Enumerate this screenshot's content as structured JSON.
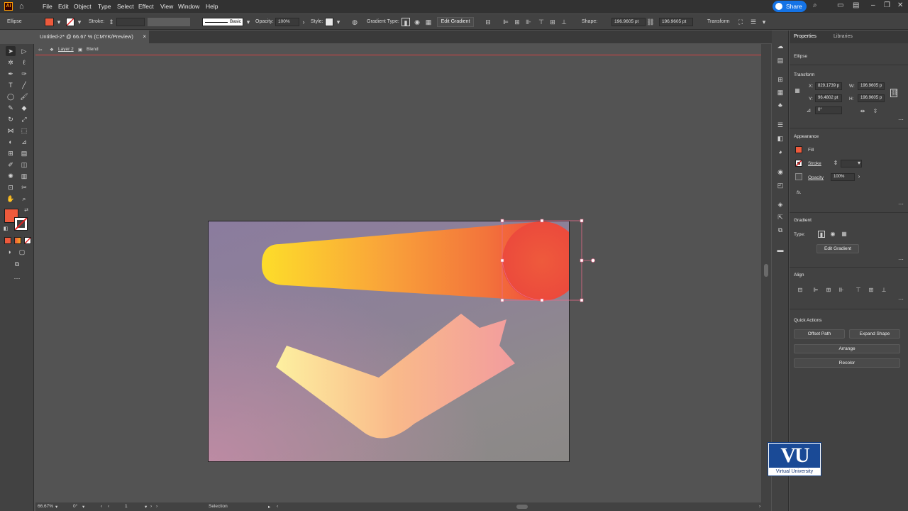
{
  "app": {
    "logo_text": "Ai"
  },
  "menu": [
    "File",
    "Edit",
    "Object",
    "Type",
    "Select",
    "Effect",
    "View",
    "Window",
    "Help"
  ],
  "share_label": "Share",
  "control_bar": {
    "object_type": "Ellipse",
    "stroke_label": "Stroke:",
    "brush_label": "Basic",
    "opacity_label": "Opacity:",
    "opacity_value": "100%",
    "style_label": "Style:",
    "gradient_type_label": "Gradient Type:",
    "edit_gradient_label": "Edit Gradient",
    "shape_label": "Shape:",
    "shape_w": "196.9605 pt",
    "shape_h": "196.9605 pt",
    "transform_label": "Transform"
  },
  "document": {
    "tab_title": "Untitled-2* @ 66.67 % (CMYK/Preview)",
    "close": "×"
  },
  "breadcrumb": {
    "layer": "Layer 2",
    "group": "Blend"
  },
  "status": {
    "zoom": "66.67%",
    "rotation": "0°",
    "artboard": "1",
    "tool": "Selection"
  },
  "colors": {
    "fill": "#ee5a3c",
    "accent": "#1473e6",
    "guide": "#d94141"
  },
  "properties": {
    "tab_properties": "Properties",
    "tab_libraries": "Libraries",
    "selection_type": "Ellipse",
    "transform": {
      "heading": "Transform",
      "x_label": "X:",
      "x_value": "829.1739 p",
      "y_label": "Y:",
      "y_value": "96.4802 pt",
      "w_label": "W:",
      "w_value": "196.9605 p",
      "h_label": "H:",
      "h_value": "196.9605 p",
      "angle_value": "0°"
    },
    "appearance": {
      "heading": "Appearance",
      "fill_label": "Fill",
      "stroke_label": "Stroke",
      "opacity_label": "Opacity",
      "opacity_value": "100%",
      "fx_label": "fx."
    },
    "gradient": {
      "heading": "Gradient",
      "type_label": "Type:",
      "edit_label": "Edit Gradient"
    },
    "align": {
      "heading": "Align"
    },
    "quick_actions": {
      "heading": "Quick Actions",
      "offset_path": "Offset Path",
      "expand_shape": "Expand Shape",
      "arrange": "Arrange",
      "recolor": "Recolor"
    }
  },
  "watermark": {
    "logo_mark": "VU",
    "name": "Virtual University"
  }
}
